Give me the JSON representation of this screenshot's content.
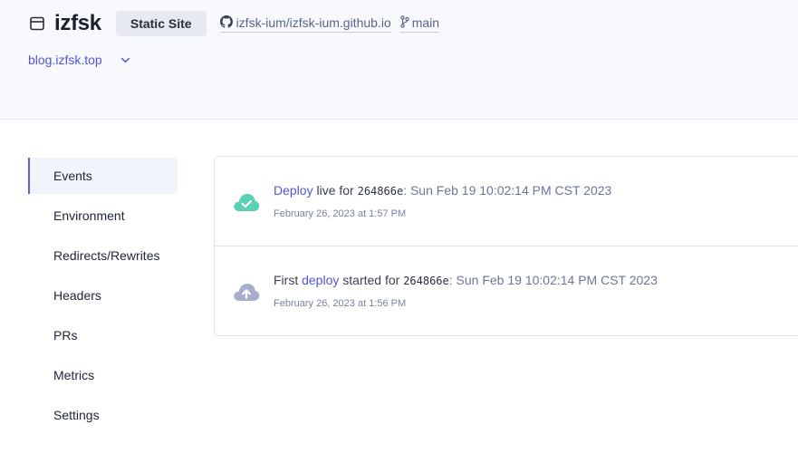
{
  "header": {
    "site_name": "izfsk",
    "badge": "Static Site",
    "repo": "izfsk-ium/izfsk-ium.github.io",
    "branch": "main",
    "domain": "blog.izfsk.top"
  },
  "sidebar": {
    "items": [
      {
        "label": "Events",
        "active": true
      },
      {
        "label": "Environment"
      },
      {
        "label": "Redirects/Rewrites"
      },
      {
        "label": "Headers"
      },
      {
        "label": "PRs"
      },
      {
        "label": "Metrics"
      },
      {
        "label": "Settings"
      }
    ]
  },
  "events": [
    {
      "icon": "cloud-check-icon",
      "icon_color": "#5ad1b3",
      "link": "Deploy",
      "text": " live for ",
      "commit": "264866e",
      "message": ": Sun Feb 19 10:02:14 PM CST 2023",
      "time": "February 26, 2023 at 1:57 PM"
    },
    {
      "icon": "cloud-upload-icon",
      "icon_color": "#a7aecd",
      "prefix": "First ",
      "link": "deploy",
      "text": " started for ",
      "commit": "264866e",
      "message": ": Sun Feb 19 10:02:14 PM CST 2023",
      "time": "February 26, 2023 at 1:56 PM"
    }
  ],
  "colors": {
    "accent": "#4f55d6",
    "header_bg": "#f8f9fd",
    "success": "#5ad1b3",
    "muted_icon": "#a7aecd"
  }
}
